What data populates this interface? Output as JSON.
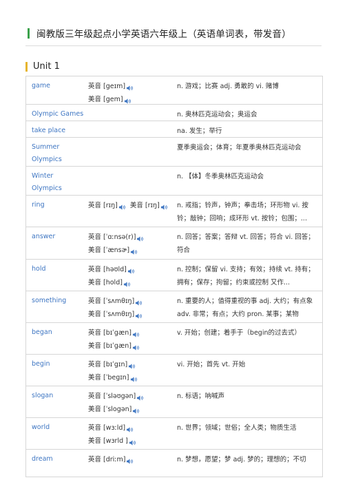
{
  "page_title": "闽教版三年级起点小学英语六年级上（英语单词表，带发音）",
  "unit_title": "Unit 1",
  "rows": [
    {
      "word": "game",
      "pron": [
        "英音 [geɪm]",
        "美音 [gem]"
      ],
      "def": "n. 游戏；比赛 adj. 勇敢的 vi. 赌博",
      "h": 41
    },
    {
      "word": "Olympic Games",
      "pron": [],
      "def": "n. 奥林匹克运动会；奥运会",
      "h": 24
    },
    {
      "word": "take place",
      "pron": [],
      "def": "na. 发生；举行",
      "h": 24
    },
    {
      "word": "Summer Olympics",
      "pron": [],
      "def": "夏季奥运会；体育；年夏季奥林匹克运动会",
      "h": 42
    },
    {
      "word": "Winter Olympics",
      "pron": [],
      "def": "n. 【体】冬季奥林匹克运动会",
      "h": 42
    },
    {
      "word": "ring",
      "pron": [
        "英音 [rɪŋ]  美音 [rɪŋ]"
      ],
      "def": "n. 戒指；铃声，钟声；拳击场；环形物 vi. 按铃；敲钟；回响；成环形 vt. 按铃；包围；...",
      "h": 46
    },
    {
      "word": "answer",
      "pron": [
        "英音 [ˈɑːnsə(r)]",
        "美音 [ˈænsɚ]"
      ],
      "def": "n. 回答；答案；答辩 vt. 回答；符合 vi. 回答；符合",
      "h": 47
    },
    {
      "word": "hold",
      "pron": [
        "英音 [həʊld]",
        "美音 [hold]"
      ],
      "def": "n. 控制；保留 vi. 支持；有效；持续 vt. 持有；拥有；保存；拘留；约束或控制 又作...",
      "h": 46
    },
    {
      "word": "something",
      "pron": [
        "英音 [ˈsʌmθɪŋ]",
        "美音 [ˈsʌmθɪŋ]"
      ],
      "def": "n. 重要的人；值得重视的事 adj. 大约；有点象 adv. 非常；有点；大约 pron. 某事；某物",
      "h": 46
    },
    {
      "word": "began",
      "pron": [
        "英音 [bɪˈgæn]",
        "美音 [bɪˈgæn]"
      ],
      "def": "v. 开始；创建；着手于（begin的过去式）",
      "h": 46
    },
    {
      "word": "begin",
      "pron": [
        "英音 [bɪˈgɪn]",
        "美音 [ˈbegɪn]"
      ],
      "def": "vi. 开始；首先 vt. 开始",
      "h": 46
    },
    {
      "word": "slogan",
      "pron": [
        "英音 [ˈsləʊgən]",
        "美音 [ˈslogən]"
      ],
      "def": "n. 标语；呐喊声",
      "h": 46
    },
    {
      "word": "world",
      "pron": [
        "英音 [wɜːld]",
        "美音 [wɜrld ]"
      ],
      "def": "n. 世界；领域；世俗；全人类；物质生活",
      "h": 46
    },
    {
      "word": "dream",
      "pron": [
        "英音 [driːm]"
      ],
      "def": "n. 梦想，愿望；梦 adj. 梦的；理想的；不切",
      "h": 40
    }
  ],
  "colors": {
    "word": "#3d75c2",
    "title_bar": "#3aa14a",
    "unit_bar": "#e6b52e",
    "speaker": "#3d75c2"
  }
}
